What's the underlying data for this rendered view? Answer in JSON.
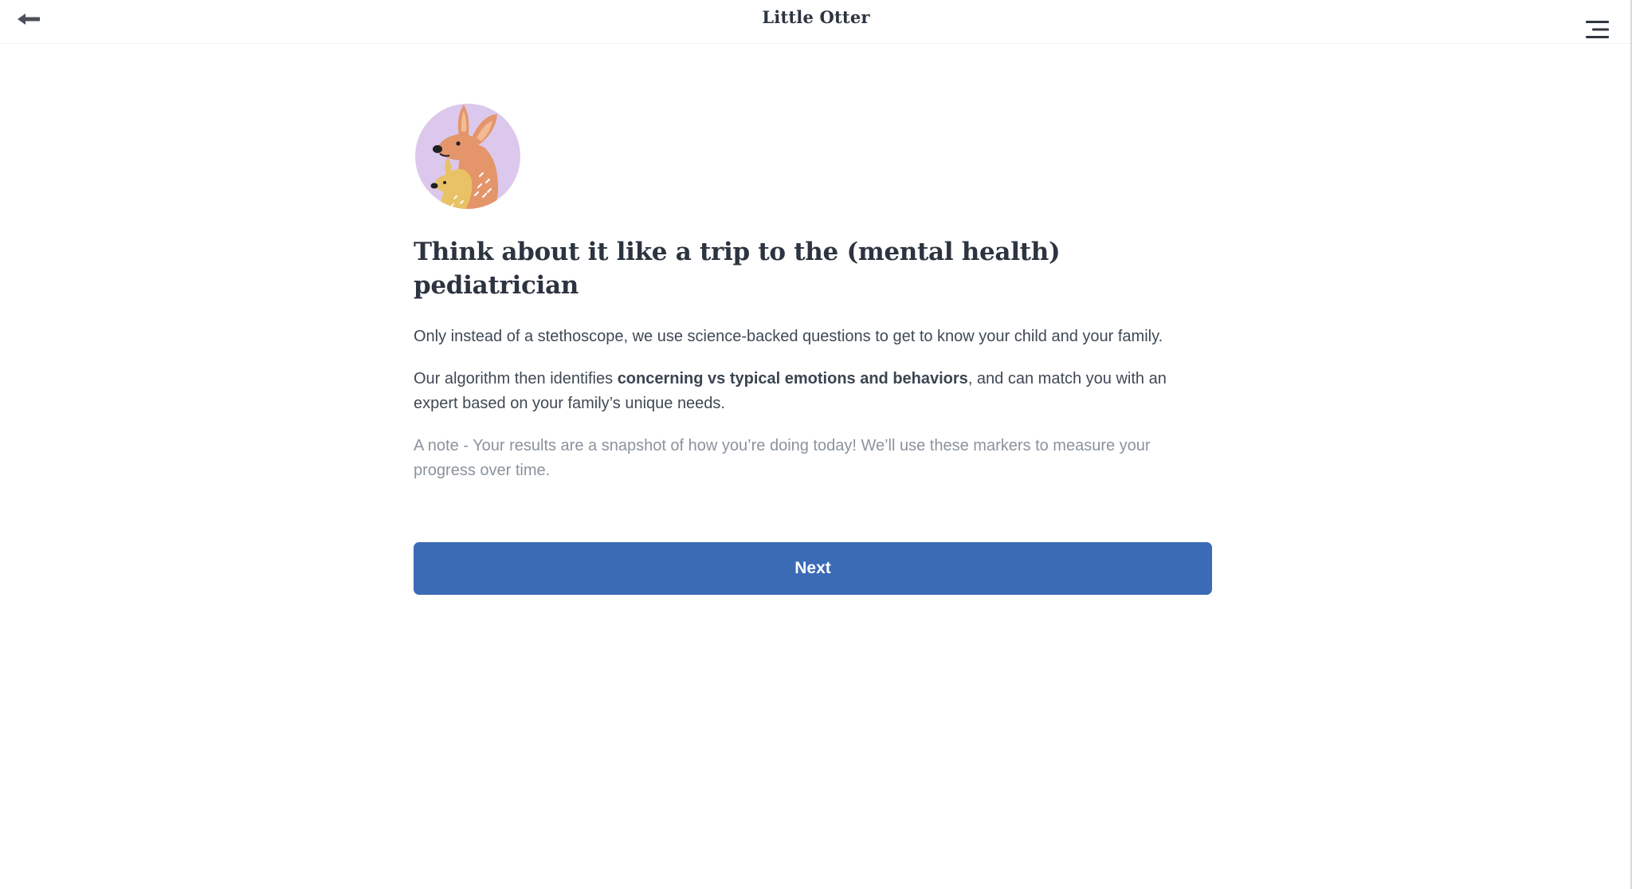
{
  "header": {
    "title": "Little Otter",
    "back_icon": "arrow-left-icon",
    "menu_icon": "hamburger-menu-icon"
  },
  "main": {
    "avatar_icon": "kangaroo-illustration",
    "headline": "Think about it like a trip to the (mental health) pediatrician",
    "para1": "Only instead of a stethoscope, we use science-backed questions to get to know your child and your family.",
    "para2": {
      "before": "Our algorithm then identifies ",
      "bold": "concerning vs typical emotions and behaviors",
      "after": ", and can match you with an expert based on your family’s unique needs."
    },
    "note": "A note - Your results are a snapshot of how you’re doing today! We’ll use these markers to measure your progress over time.",
    "next_label": "Next"
  },
  "colors": {
    "button": "#3b6bb5",
    "text": "#3f4955",
    "note": "#8a939d",
    "avatar_bg": "#dcc8ec",
    "kangaroo": "#e4956a",
    "joey": "#e8c265"
  }
}
